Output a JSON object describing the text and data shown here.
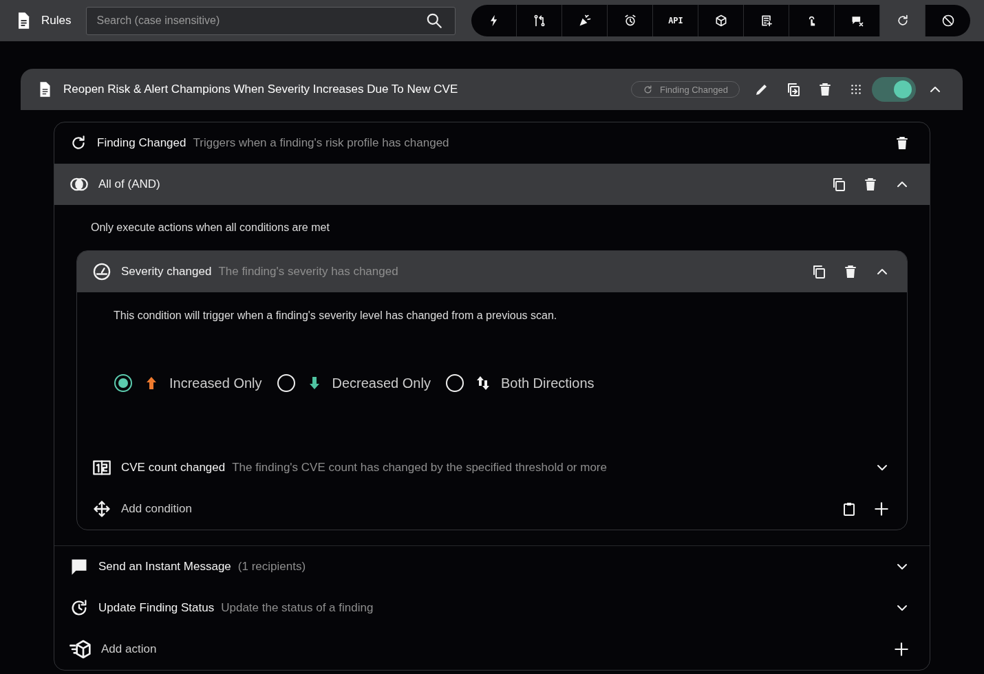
{
  "app": {
    "title": "Rules"
  },
  "search": {
    "placeholder": "Search (case insensitive)"
  },
  "toolbar": [
    {
      "kind": "bolt",
      "selected": false
    },
    {
      "kind": "branches",
      "selected": false
    },
    {
      "kind": "party",
      "selected": false
    },
    {
      "kind": "alarm",
      "selected": false
    },
    {
      "kind": "api",
      "label": "API",
      "selected": false
    },
    {
      "kind": "cube",
      "selected": false
    },
    {
      "kind": "note",
      "selected": false
    },
    {
      "kind": "touch",
      "selected": false
    },
    {
      "kind": "chat",
      "selected": false
    },
    {
      "kind": "refresh",
      "selected": true
    },
    {
      "kind": "block",
      "selected": false
    }
  ],
  "rule": {
    "title": "Reopen Risk & Alert Champions When Severity Increases Due To New CVE",
    "trigger_chip": "Finding Changed",
    "enabled": true,
    "expanded": true
  },
  "trigger": {
    "title": "Finding Changed",
    "description": "Triggers when a finding's risk profile has changed"
  },
  "group": {
    "title": "All of (AND)",
    "expanded": true,
    "hint": "Only execute actions when all conditions are met",
    "conditions": [
      {
        "kind": "severity",
        "title": "Severity changed",
        "description": "The finding's severity has changed",
        "expanded": true,
        "detail": "This condition will trigger when a finding's severity level has changed from a previous scan.",
        "options": [
          {
            "kind": "up",
            "label": "Increased Only",
            "selected": true
          },
          {
            "kind": "down",
            "label": "Decreased Only",
            "selected": false
          },
          {
            "kind": "both",
            "label": "Both Directions",
            "selected": false
          }
        ]
      },
      {
        "kind": "count",
        "title": "CVE count changed",
        "description": "The finding's CVE count has changed by the specified threshold or more",
        "expanded": false
      }
    ],
    "add_label": "Add condition"
  },
  "actions": [
    {
      "kind": "message",
      "title": "Send an Instant Message",
      "description": "(1 recipients)",
      "expanded": false
    },
    {
      "kind": "status",
      "title": "Update Finding Status",
      "description": "Update the status of a finding",
      "expanded": false
    }
  ],
  "add_action": "Add action"
}
